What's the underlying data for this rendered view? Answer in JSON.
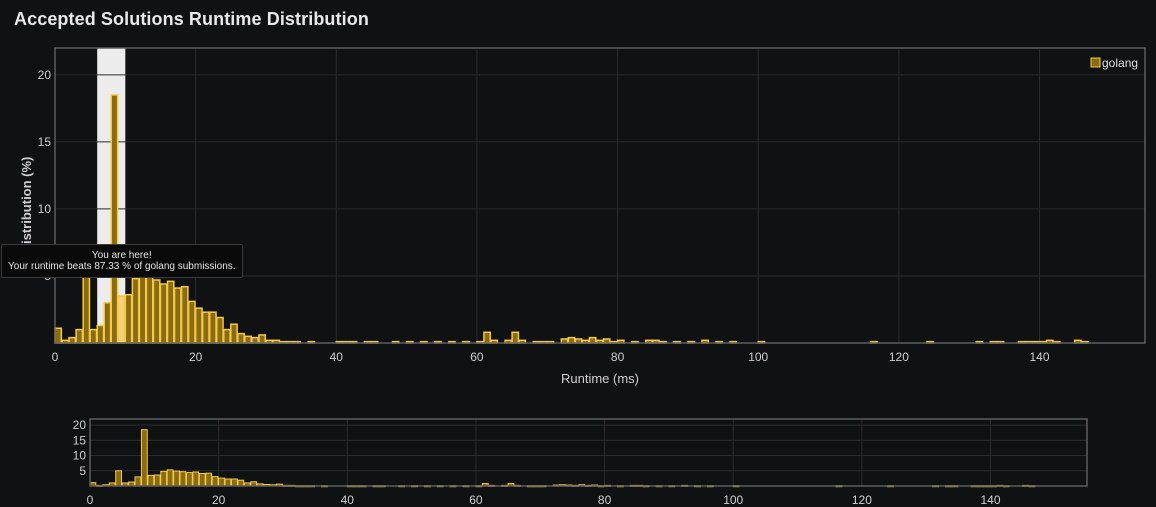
{
  "title": "Accepted Solutions Runtime Distribution",
  "colors": {
    "background": "#101113",
    "bar_fill": "#8a6b0f",
    "bar_stroke": "#f2c94c",
    "bar_highlight_fill": "#f5d27a",
    "highlight_band": "#ececec",
    "grid": "#2a2b2d",
    "frame": "#5e5e5e"
  },
  "tooltip": {
    "line1": "You are here!",
    "line2": "Your runtime beats 87.33 % of golang submissions."
  },
  "chart_data": [
    {
      "id": "main",
      "type": "bar",
      "xlabel": "Runtime (ms)",
      "ylabel": "Distribution (%)",
      "xlim": [
        0,
        155
      ],
      "ylim": [
        0,
        22
      ],
      "xticks": [
        "0",
        "20",
        "40",
        "60",
        "80",
        "100",
        "120",
        "140"
      ],
      "yticks": [
        "5",
        "10",
        "15",
        "20"
      ],
      "legend": {
        "label": "golang",
        "position": "top-right"
      },
      "grid": true,
      "highlight_range": [
        6,
        10
      ],
      "highlight_bin": 9,
      "x": [
        0,
        1,
        2,
        3,
        4,
        5,
        6,
        7,
        8,
        9,
        10,
        11,
        12,
        13,
        14,
        15,
        16,
        17,
        18,
        19,
        20,
        21,
        22,
        23,
        24,
        25,
        26,
        27,
        28,
        29,
        30,
        31,
        32,
        33,
        34,
        36,
        40,
        41,
        42,
        44,
        45,
        48,
        50,
        52,
        54,
        56,
        58,
        60,
        61,
        62,
        64,
        65,
        66,
        68,
        69,
        70,
        72,
        73,
        74,
        75,
        76,
        77,
        78,
        79,
        80,
        82,
        84,
        85,
        86,
        88,
        90,
        92,
        94,
        96,
        100,
        116,
        124,
        131,
        133,
        134,
        137,
        138,
        139,
        140,
        141,
        142,
        145,
        146
      ],
      "y": [
        1.1,
        0.2,
        0.4,
        1.0,
        5.0,
        1.0,
        1.3,
        3.0,
        18.5,
        3.5,
        3.6,
        4.8,
        5.3,
        4.9,
        4.7,
        4.4,
        4.6,
        4.1,
        4.2,
        3.1,
        2.6,
        2.3,
        2.3,
        1.9,
        1.0,
        1.4,
        0.7,
        0.5,
        0.4,
        0.6,
        0.2,
        0.2,
        0.1,
        0.1,
        0.1,
        0.1,
        0.1,
        0.1,
        0.1,
        0.1,
        0.1,
        0.1,
        0.1,
        0.1,
        0.1,
        0.1,
        0.1,
        0.1,
        0.8,
        0.2,
        0.2,
        0.8,
        0.2,
        0.1,
        0.1,
        0.1,
        0.3,
        0.4,
        0.3,
        0.2,
        0.4,
        0.2,
        0.3,
        0.1,
        0.2,
        0.1,
        0.2,
        0.2,
        0.1,
        0.1,
        0.1,
        0.2,
        0.1,
        0.1,
        0.1,
        0.1,
        0.1,
        0.1,
        0.1,
        0.1,
        0.1,
        0.1,
        0.1,
        0.1,
        0.2,
        0.1,
        0.2,
        0.1
      ]
    },
    {
      "id": "navigator",
      "type": "bar",
      "xlim": [
        0,
        155
      ],
      "ylim": [
        0,
        22
      ],
      "xticks": [
        "0",
        "20",
        "40",
        "60",
        "80",
        "100",
        "120",
        "140"
      ],
      "yticks": [
        "5",
        "10",
        "15",
        "20"
      ],
      "grid": true,
      "series_ref": "main"
    }
  ]
}
